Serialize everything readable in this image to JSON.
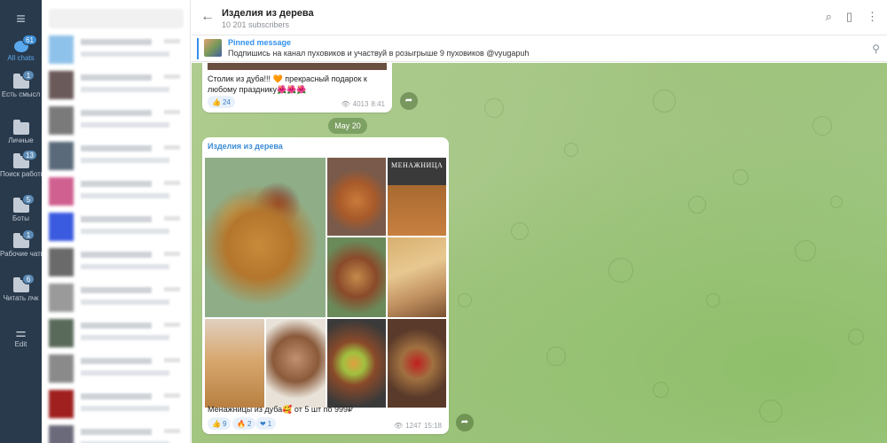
{
  "colors": {
    "rail_bg": "#293a4c",
    "accent": "#3390ec",
    "chat_bg": "#a3c98a"
  },
  "folders": [
    {
      "name": "folder-all-chats",
      "icon": "chat-bubble-icon",
      "label": "All chats",
      "badge": "61",
      "active": true
    },
    {
      "name": "folder-est-smysl",
      "icon": "folder-icon",
      "label": "Есть смысл",
      "badge": "1"
    },
    {
      "name": "folder-lichnye",
      "icon": "folder-icon",
      "label": "Личные",
      "badge": ""
    },
    {
      "name": "folder-poisk-raboty",
      "icon": "folder-icon",
      "label": "Поиск работы",
      "badge": "13"
    },
    {
      "name": "folder-boty",
      "icon": "folder-icon",
      "label": "Боты",
      "badge": "5"
    },
    {
      "name": "folder-rabochie-chaty",
      "icon": "folder-icon",
      "label": "Рабочие чаты",
      "badge": "1"
    },
    {
      "name": "folder-chitat-lchk",
      "icon": "folder-icon",
      "label": "Читать лчк",
      "badge": "6"
    },
    {
      "name": "folder-edit",
      "icon": "sliders-icon",
      "label": "Edit",
      "badge": ""
    }
  ],
  "header": {
    "title": "Изделия из дерева",
    "subtitle": "10 201 subscribers"
  },
  "pinned": {
    "title": "Pinned message",
    "text": "Подпишись на канал пуховиков и участвуй в розыгрыше 9 пуховиков @vyugapuh"
  },
  "messages": {
    "first": {
      "text": "Столик из дуба!!! 🧡 прекрасный подарок к любому празднику🌺🌺🌺",
      "reaction_emoji": "👍",
      "reaction_count": "24",
      "views": "4013",
      "time": "8:41"
    },
    "date_divider": "May 20",
    "second": {
      "channel": "Изделия из дерева",
      "text": "Менажницы из дуба🥰 от 5 шт по 999₽",
      "reactions": [
        {
          "emoji": "👍",
          "count": "9"
        },
        {
          "emoji": "🔥",
          "count": "2"
        },
        {
          "emoji": "❤",
          "count": "1"
        }
      ],
      "views": "1247",
      "time": "15:18",
      "photo_caption": "МЕНАЖНИЦА"
    }
  }
}
